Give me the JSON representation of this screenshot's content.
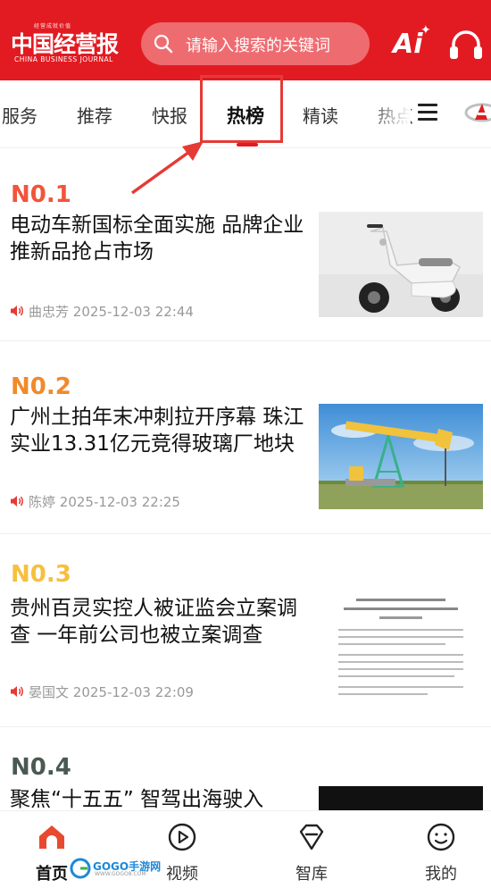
{
  "header": {
    "logo_small": "经营成就价值",
    "logo_main": "中国经营报",
    "logo_en": "CHINA BUSINESS JOURNAL",
    "search_placeholder": "请输入搜索的关键词",
    "ai_label": "Ai"
  },
  "tabs": [
    {
      "label": "服务",
      "active": false
    },
    {
      "label": "推荐",
      "active": false
    },
    {
      "label": "快报",
      "active": false
    },
    {
      "label": "热榜",
      "active": true
    },
    {
      "label": "精读",
      "active": false
    },
    {
      "label": "热点",
      "active": false
    }
  ],
  "articles": [
    {
      "rank": "N0.1",
      "rank_color": "#f0553c",
      "title": "电动车新国标全面实施 品牌企业推新品抢占市场",
      "author": "曲忠芳",
      "time": "2025-12-03 22:44",
      "thumbnail": "scooter-photo"
    },
    {
      "rank": "N0.2",
      "rank_color": "#f08a2c",
      "title": "广州土拍年末冲刺拉开序幕 珠江实业13.31亿元竞得玻璃厂地块",
      "author": "陈婷",
      "time": "2025-12-03 22:25",
      "thumbnail": "oil-pump-photo"
    },
    {
      "rank": "N0.3",
      "rank_color": "#f5c040",
      "title": "贵州百灵实控人被证监会立案调查 一年前公司也被立案调查",
      "author": "晏国文",
      "time": "2025-12-03 22:09",
      "thumbnail": "document-photo"
    },
    {
      "rank": "N0.4",
      "rank_color": "#4a5a52",
      "title": "聚焦“十五五” 智驾出海驶入",
      "author": "",
      "time": "",
      "thumbnail": "dark-photo"
    }
  ],
  "bottom_nav": [
    {
      "label": "首页",
      "icon": "home-icon",
      "active": true
    },
    {
      "label": "视频",
      "icon": "video-icon",
      "active": false
    },
    {
      "label": "智库",
      "icon": "think-tank-icon",
      "active": false
    },
    {
      "label": "我的",
      "icon": "profile-icon",
      "active": false
    }
  ],
  "watermark": {
    "text": "GOGO手游网",
    "url": "WWW.GOGO8.COM"
  },
  "colors": {
    "brand_red": "#e21b22",
    "highlight": "#e53a35",
    "meta": "#999999"
  }
}
